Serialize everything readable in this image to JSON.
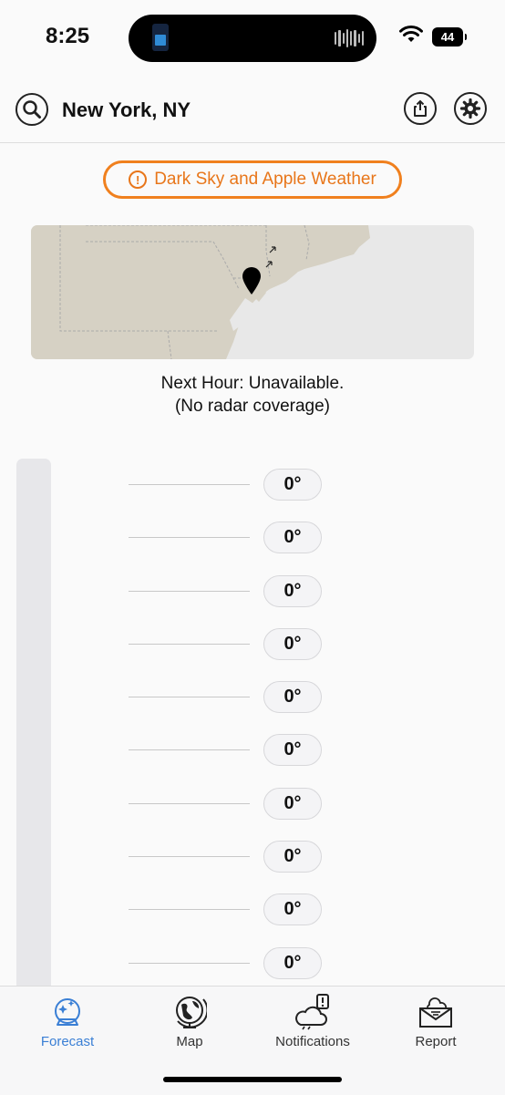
{
  "status_bar": {
    "time": "8:25",
    "battery": "44"
  },
  "header": {
    "location": "New York, NY"
  },
  "alert": {
    "label": "Dark Sky and Apple Weather",
    "icon": "!"
  },
  "map": {
    "caption_line1": "Next Hour: Unavailable.",
    "caption_line2": "(No radar coverage)"
  },
  "temps": [
    "0°",
    "0°",
    "0°",
    "0°",
    "0°",
    "0°",
    "0°",
    "0°",
    "0°",
    "0°"
  ],
  "tabs": [
    {
      "label": "Forecast",
      "icon": "crystal-ball-icon",
      "active": true
    },
    {
      "label": "Map",
      "icon": "globe-icon",
      "active": false
    },
    {
      "label": "Notifications",
      "icon": "cloud-alert-icon",
      "active": false
    },
    {
      "label": "Report",
      "icon": "envelope-icon",
      "active": false
    }
  ],
  "colors": {
    "accent": "#3a7fd5",
    "alert": "#f0801e",
    "land": "#d6d1c4",
    "water": "#e8e8e8"
  }
}
